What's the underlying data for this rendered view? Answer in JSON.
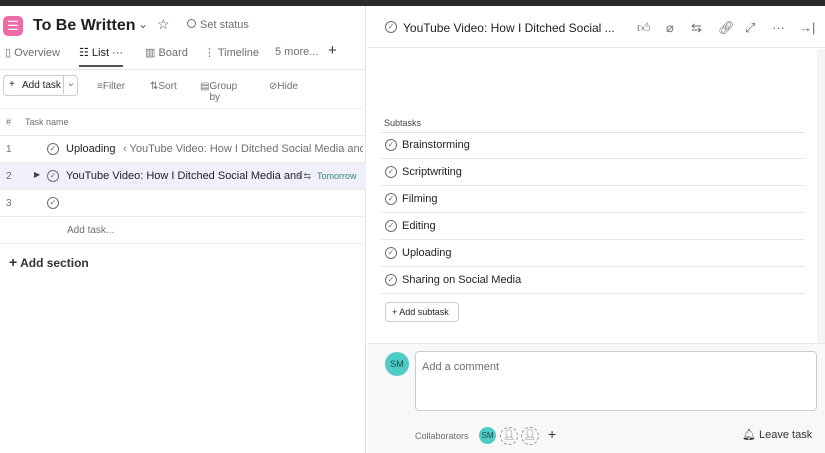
{
  "project": {
    "title": "To Be Written",
    "set_status": "Set status"
  },
  "tabs": [
    "Overview",
    "List",
    "Board",
    "Timeline",
    "5 more..."
  ],
  "toolbar": {
    "add_task": "Add task",
    "filter": "Filter",
    "sort": "Sort",
    "group_by": "Group by",
    "hide": "Hide"
  },
  "table": {
    "col_num": "#",
    "col_name": "Task name",
    "rows": [
      {
        "num": "1",
        "name": "Uploading",
        "parent": "‹ YouTube Video: How I Ditched Social Media and I"
      },
      {
        "num": "2",
        "name": "YouTube Video: How I Ditched Social Media and",
        "subtask_count": "6",
        "due": "Tomorrow"
      },
      {
        "num": "3",
        "name": ""
      }
    ],
    "add_task": "Add task...",
    "add_section": "Add section"
  },
  "detail": {
    "title": "YouTube Video: How I Ditched Social ...",
    "subtasks_label": "Subtasks",
    "subtasks": [
      "Brainstorming",
      "Scriptwriting",
      "Filming",
      "Editing",
      "Uploading",
      "Sharing on Social Media"
    ],
    "add_subtask": "Add subtask",
    "comment_placeholder": "Add a comment",
    "avatar_initials": "SM",
    "collaborators_label": "Collaborators",
    "leave_task": "Leave task"
  },
  "colors": {
    "accent_pink": "#f06aa8",
    "avatar": "#4ecbc4",
    "due_green": "#2e8a6b"
  }
}
